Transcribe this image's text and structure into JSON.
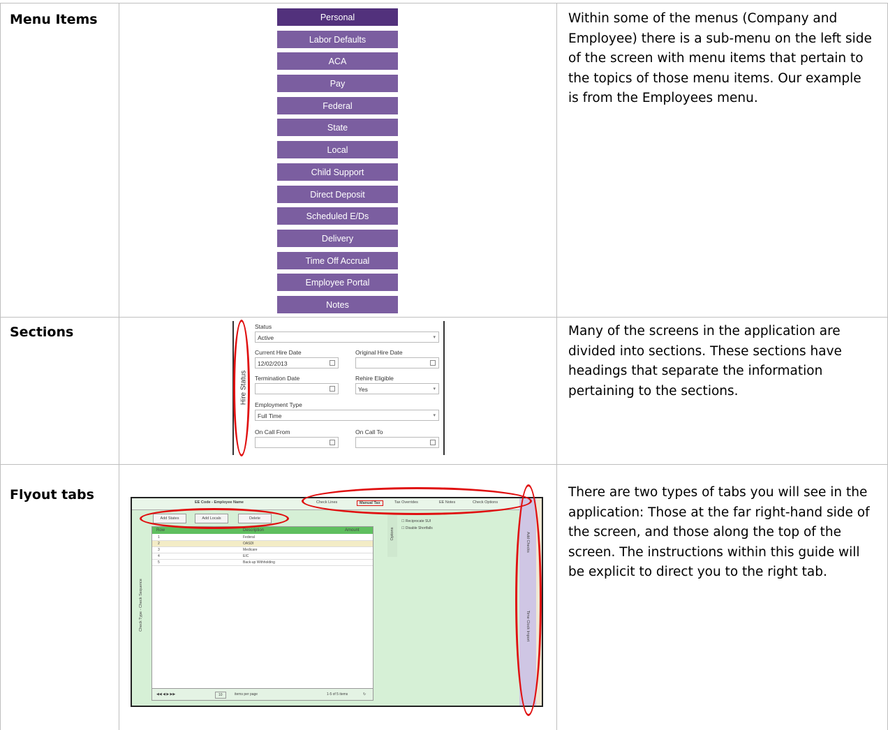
{
  "rows": [
    {
      "label": "Menu Items",
      "description": "Within some of the menus (Company and Employee) there is a sub-menu on the left side of the screen with menu items that pertain to the topics of those menu items. Our example is from the Employees menu."
    },
    {
      "label": "Sections",
      "description": "Many of the screens in the application are divided into sections. These sections have headings that separate the information pertaining to the sections."
    },
    {
      "label": "Flyout tabs",
      "description": "There are two types of tabs you will see in the application: Those at the far right-hand side of the screen, and those along the top of the screen. The instructions within this guide will be explicit to direct you to the right tab."
    }
  ],
  "menu_items": [
    "Personal",
    "Labor Defaults",
    "ACA",
    "Pay",
    "Federal",
    "State",
    "Local",
    "Child Support",
    "Direct Deposit",
    "Scheduled E/Ds",
    "Delivery",
    "Time Off Accrual",
    "Employee Portal",
    "Notes"
  ],
  "colors": {
    "menu_active": "#52317c",
    "menu_item": "#7b5ea0",
    "highlight": "#e01010",
    "flyout_bg": "#d6f0d6"
  },
  "sections_example": {
    "side_heading": "Hire Status",
    "status_label": "Status",
    "status_value": "Active",
    "current_hire_label": "Current Hire Date",
    "current_hire_value": "12/02/2013",
    "original_hire_label": "Original Hire Date",
    "termination_label": "Termination Date",
    "rehire_label": "Rehire Eligible",
    "rehire_value": "Yes",
    "employment_type_label": "Employment Type",
    "employment_type_value": "Full Time",
    "on_call_from_label": "On Call From",
    "on_call_to_label": "On Call To"
  },
  "flyout_example": {
    "header": "EE Code - Employee Name",
    "top_tabs": [
      "Check Lines",
      "Manual Tax",
      "Tax Overrides",
      "EE Notes",
      "Check Options"
    ],
    "buttons": [
      "Add States",
      "Add Locals",
      "Delete"
    ],
    "columns": [
      "Row",
      "Description",
      "Amount"
    ],
    "table_rows": [
      {
        "n": "1",
        "desc": "Federal"
      },
      {
        "n": "2",
        "desc": "OASDI"
      },
      {
        "n": "3",
        "desc": "Medicare"
      },
      {
        "n": "4",
        "desc": "EIC"
      },
      {
        "n": "5",
        "desc": "Back-up Withholding"
      }
    ],
    "side_label": "Check Type - Check Sequence",
    "options_label": "Options",
    "options": [
      "Reciprocate SUI",
      "Disable Shortfalls"
    ],
    "right_tabs": [
      "Add Checks",
      "Time Clock Import"
    ],
    "pager_size": "10",
    "pager_text": "items per page",
    "pager_count": "1-5 of 5 items"
  }
}
